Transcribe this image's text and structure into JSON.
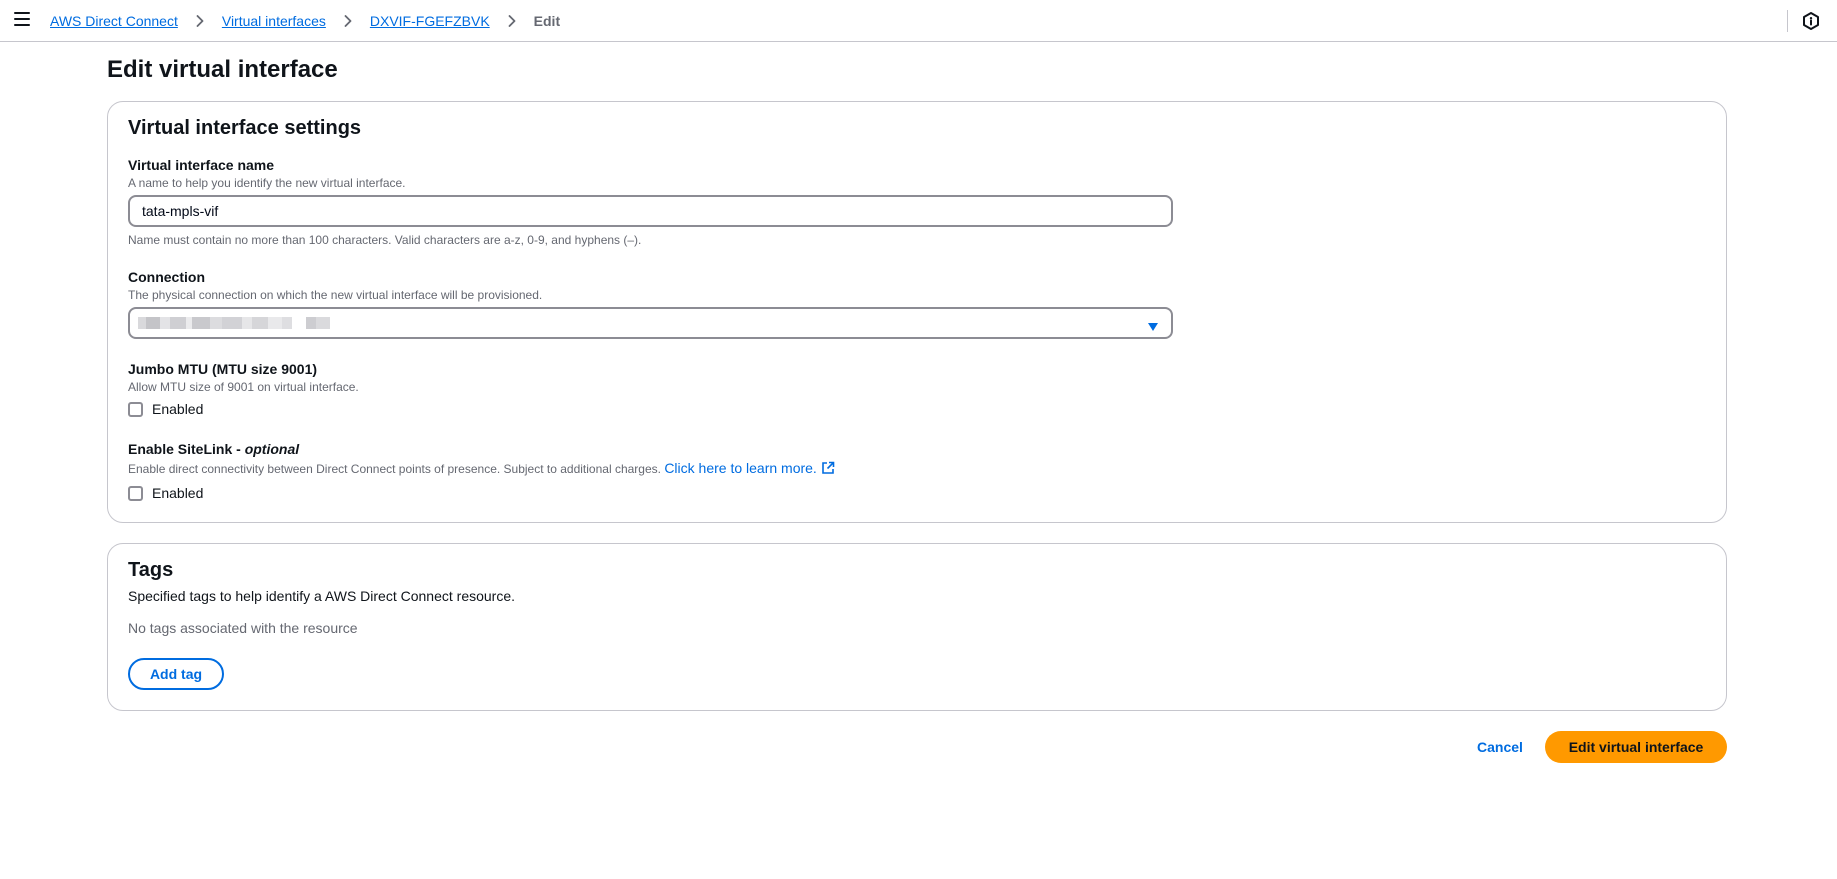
{
  "breadcrumb": {
    "items": [
      "AWS Direct Connect",
      "Virtual interfaces",
      "DXVIF-FGEFZBVK"
    ],
    "current": "Edit"
  },
  "page": {
    "title": "Edit virtual interface"
  },
  "settings": {
    "title": "Virtual interface settings",
    "name": {
      "label": "Virtual interface name",
      "description": "A name to help you identify the new virtual interface.",
      "value": "tata-mpls-vif",
      "constraint": "Name must contain no more than 100 characters. Valid characters are a-z, 0-9, and hyphens (–)."
    },
    "connection": {
      "label": "Connection",
      "description": "The physical connection on which the new virtual interface will be provisioned."
    },
    "jumbo": {
      "label": "Jumbo MTU (MTU size 9001)",
      "description": "Allow MTU size of 9001 on virtual interface.",
      "checkbox_label": "Enabled",
      "checked": false
    },
    "sitelink": {
      "label": "Enable SiteLink - ",
      "label_optional": "optional",
      "description": "Enable direct connectivity between Direct Connect points of presence. Subject to additional charges. ",
      "link": "Click here to learn more.",
      "checkbox_label": "Enabled",
      "checked": false
    }
  },
  "tags": {
    "title": "Tags",
    "description": "Specified tags to help identify a AWS Direct Connect resource.",
    "empty": "No tags associated with the resource",
    "add_button": "Add tag"
  },
  "actions": {
    "cancel": "Cancel",
    "submit": "Edit virtual interface"
  },
  "icons": {
    "menu": "hamburger-menu-icon",
    "separator": "chevron-right-icon",
    "help": "info-hexagon-icon",
    "dropdown": "caret-down-icon",
    "external": "external-link-icon"
  },
  "colors": {
    "link": "#006ce0",
    "primary": "#ff9900",
    "border": "#c6c6cd",
    "text": "#0f141a",
    "muted": "#656871"
  }
}
